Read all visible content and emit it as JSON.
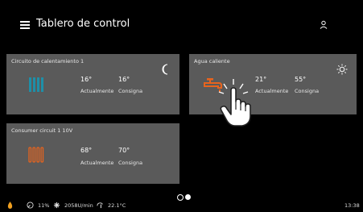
{
  "header": {
    "title": "Tablero de control"
  },
  "cards": [
    {
      "title": "Circuito de calentamiento 1",
      "current": "16°",
      "setpoint": "16°",
      "current_label": "Actualmente",
      "setpoint_label": "Consigna",
      "mode_icon": "moon-icon",
      "device_icon": "radiator-icon",
      "device_color": "#1e8fa8"
    },
    {
      "title": "Agua caliente",
      "current": "21°",
      "setpoint": "55°",
      "current_label": "Actualmente",
      "setpoint_label": "Consigna",
      "mode_icon": "sun-icon",
      "device_icon": "faucet-icon",
      "device_color": "#e8641e"
    },
    {
      "title": "Consumer circuit 1 10V",
      "current": "68°",
      "setpoint": "70°",
      "current_label": "Actualmente",
      "setpoint_label": "Consigna",
      "device_icon": "radiator-icon",
      "device_color": "#e8641e"
    }
  ],
  "status": {
    "modulation": "11%",
    "fan_speed": "2058U/min",
    "outside_temp": "22.1°C",
    "time": "13:38"
  },
  "pagination": {
    "pages": 2,
    "active": 1
  }
}
